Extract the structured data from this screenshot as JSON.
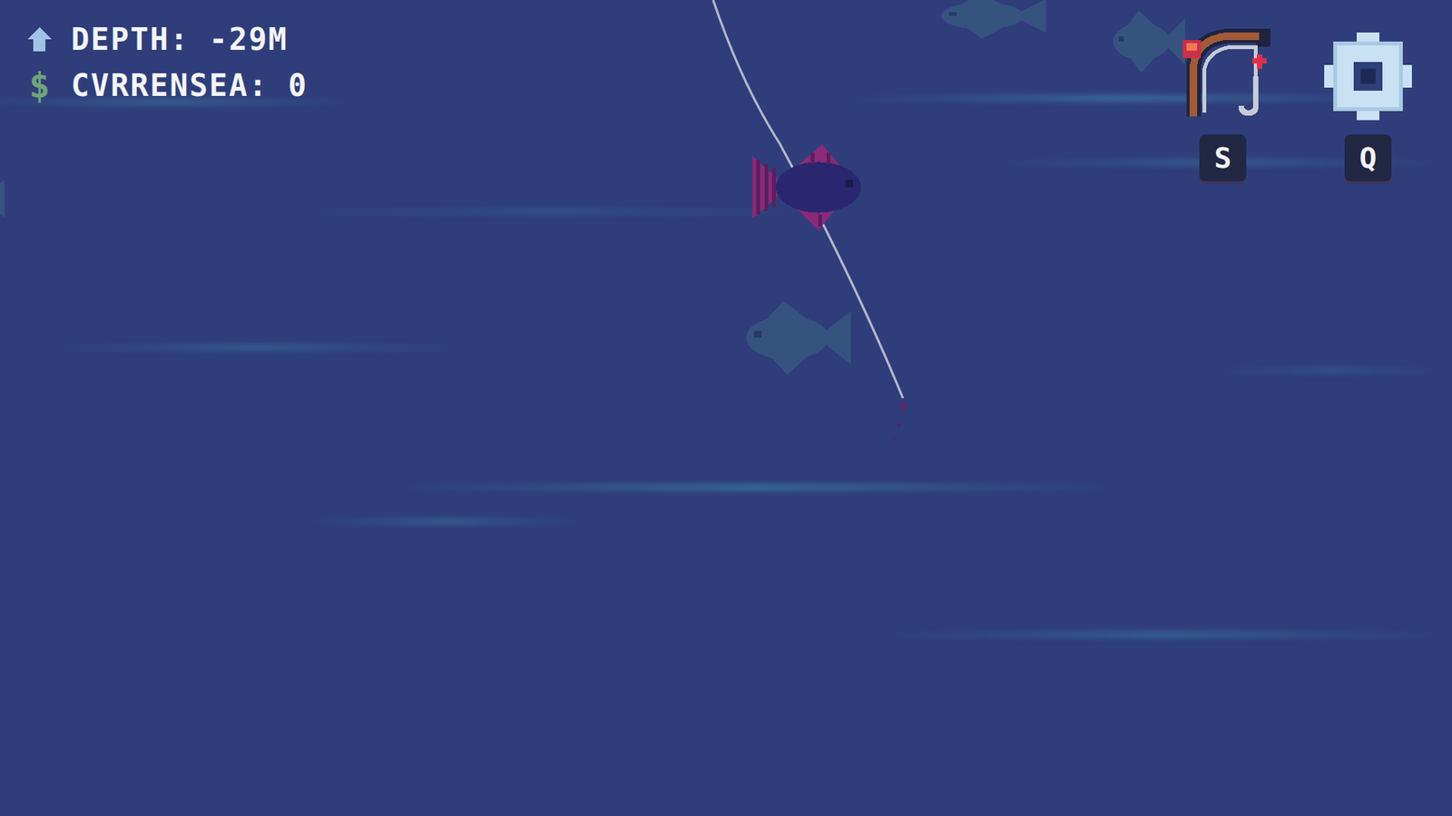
{
  "hud": {
    "depth": {
      "label": "DEPTH: -29M"
    },
    "currency": {
      "icon": "$",
      "label": "CVRRENSEA: 0"
    }
  },
  "tools": [
    {
      "name": "rod",
      "key": "S"
    },
    {
      "name": "settings",
      "key": "Q"
    }
  ],
  "fish": [
    {
      "hooked": true,
      "color": "#8a2a78"
    },
    {
      "hooked": false,
      "color": "#3f6d88"
    },
    {
      "hooked": false,
      "color": "#3f6d88"
    },
    {
      "hooked": false,
      "color": "#3f6d88"
    },
    {
      "hooked": false,
      "color": "#3f6d88"
    }
  ]
}
